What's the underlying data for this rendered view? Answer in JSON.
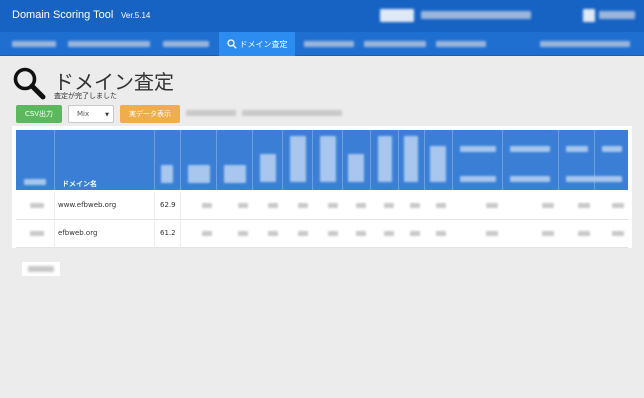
{
  "app": {
    "title": "Domain Scoring Tool",
    "version": "Ver.5.14"
  },
  "nav": {
    "active_label": "ドメイン査定"
  },
  "page": {
    "title": "ドメイン査定",
    "subtitle": "査定が完了しました"
  },
  "toolbar": {
    "csv_label": "CSV出力",
    "mix_value": "Mix",
    "real_data_label": "実データ表示"
  },
  "table": {
    "domain_header": "ドメイン名",
    "rows": [
      {
        "domain": "www.efbweb.org",
        "score": "62.9"
      },
      {
        "domain": "efbweb.org",
        "score": "61.2"
      }
    ]
  },
  "colors": {
    "header_bg": "#1763c4",
    "nav_active": "#2d8cf0",
    "csv_btn": "#5cb85c",
    "real_btn": "#f0ad4e",
    "table_head": "#3a7fd5"
  }
}
